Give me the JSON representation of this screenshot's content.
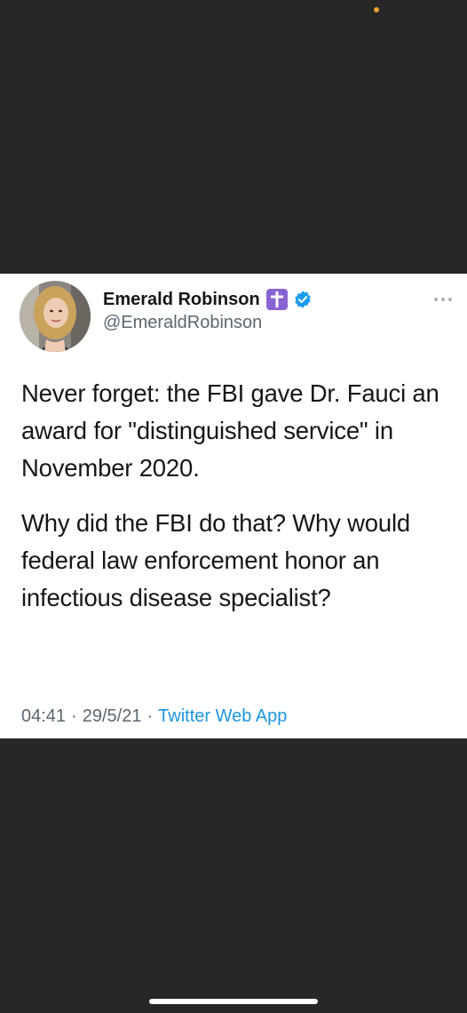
{
  "colors": {
    "background": "#272727",
    "card": "#ffffff",
    "text_primary": "#14171a",
    "text_secondary": "#5b6670",
    "link": "#1b95e0",
    "verified": "#1d9bf0",
    "cross_badge": "#8a63d2",
    "status_dot": "#f0a030"
  },
  "tweet": {
    "author": {
      "name": "Emerald Robinson",
      "handle": "@EmeraldRobinson",
      "avatar_icon": "avatar-photo",
      "badges": [
        "cross-icon",
        "verified-icon"
      ]
    },
    "paragraphs": [
      "Never forget: the FBI gave Dr. Fauci an award for \"distinguished service\" in November 2020.",
      "Why did the FBI do that? Why would federal law enforcement honor an infectious disease specialist?"
    ],
    "time": "04:41",
    "date": "29/5/21",
    "separator": "·",
    "source": "Twitter Web App",
    "more_icon": "more-icon"
  }
}
